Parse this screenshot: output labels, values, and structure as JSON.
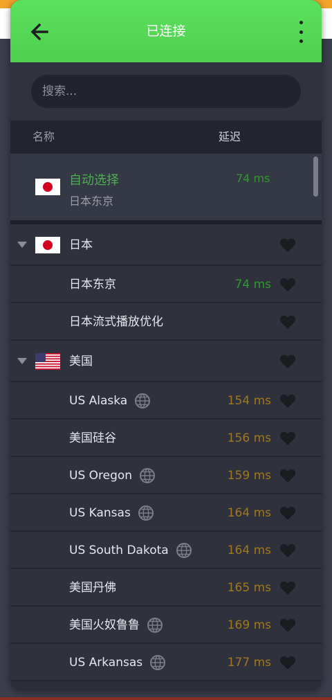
{
  "header": {
    "title": "已连接"
  },
  "search": {
    "placeholder": "搜索..."
  },
  "columns": {
    "name": "名称",
    "latency": "延迟"
  },
  "auto": {
    "name": "自动选择",
    "location": "日本东京",
    "latency": "74 ms"
  },
  "groups": {
    "japan": {
      "name": "日本",
      "servers": [
        {
          "name": "日本东京",
          "latency": "74 ms",
          "status": "good"
        },
        {
          "name": "日本流式播放优化",
          "latency": "",
          "status": "none"
        }
      ]
    },
    "usa": {
      "name": "美国",
      "servers": [
        {
          "name": "US Alaska",
          "latency": "154 ms",
          "status": "medium",
          "globe": true
        },
        {
          "name": "美国硅谷",
          "latency": "156 ms",
          "status": "medium",
          "globe": false
        },
        {
          "name": "US Oregon",
          "latency": "159 ms",
          "status": "medium",
          "globe": true
        },
        {
          "name": "US Kansas",
          "latency": "164 ms",
          "status": "medium",
          "globe": true
        },
        {
          "name": "US South Dakota",
          "latency": "164 ms",
          "status": "medium",
          "globe": true
        },
        {
          "name": "美国丹佛",
          "latency": "165 ms",
          "status": "medium",
          "globe": false
        },
        {
          "name": "美国火奴鲁鲁",
          "latency": "169 ms",
          "status": "medium",
          "globe": true
        },
        {
          "name": "US Arkansas",
          "latency": "177 ms",
          "status": "medium",
          "globe": true
        }
      ]
    }
  },
  "colors": {
    "header_green": "#5be15d",
    "latency_good": "#2e9a2e",
    "latency_medium": "#a0781c",
    "auto_select_text": "#4caf50"
  },
  "icons": [
    "back-arrow-icon",
    "more-vert-icon",
    "japan-flag-icon",
    "us-flag-icon",
    "heart-icon",
    "globe-icon",
    "expand-arrow-icon"
  ]
}
